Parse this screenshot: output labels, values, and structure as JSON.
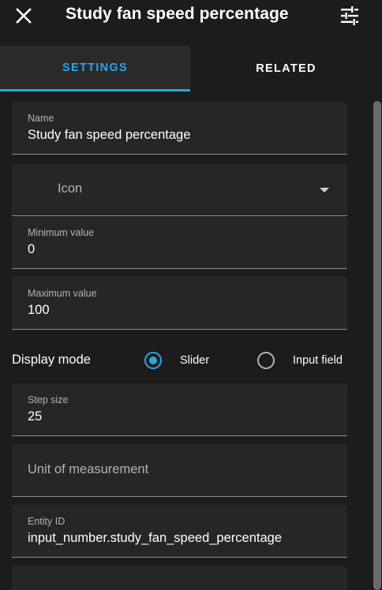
{
  "header": {
    "title": "Study fan speed percentage",
    "close_icon": "close-icon",
    "settings_icon": "tune-icon"
  },
  "tabs": [
    {
      "label": "SETTINGS",
      "active": true
    },
    {
      "label": "RELATED",
      "active": false
    }
  ],
  "form": {
    "name": {
      "label": "Name",
      "value": "Study fan speed percentage"
    },
    "icon": {
      "placeholder": "Icon"
    },
    "minimum": {
      "label": "Minimum value",
      "value": "0"
    },
    "maximum": {
      "label": "Maximum value",
      "value": "100"
    },
    "display_mode": {
      "label": "Display mode",
      "options": [
        {
          "label": "Slider",
          "selected": true
        },
        {
          "label": "Input field",
          "selected": false
        }
      ]
    },
    "step": {
      "label": "Step size",
      "value": "25"
    },
    "unit": {
      "placeholder": "Unit of measurement"
    },
    "entity_id": {
      "label": "Entity ID",
      "value": "input_number.study_fan_speed_percentage"
    }
  },
  "colors": {
    "accent": "#2aa5e6",
    "background": "#1c1c1c",
    "field_background": "#262626"
  }
}
